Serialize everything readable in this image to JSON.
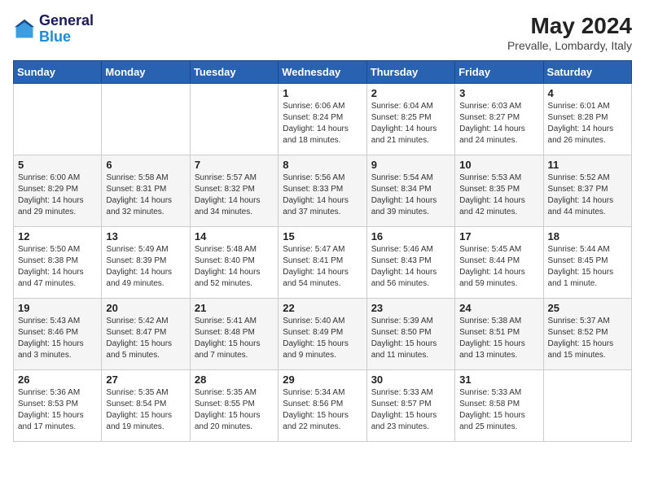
{
  "logo": {
    "line1": "General",
    "line2": "Blue"
  },
  "title": "May 2024",
  "location": "Prevalle, Lombardy, Italy",
  "weekdays": [
    "Sunday",
    "Monday",
    "Tuesday",
    "Wednesday",
    "Thursday",
    "Friday",
    "Saturday"
  ],
  "weeks": [
    [
      {
        "day": "",
        "text": ""
      },
      {
        "day": "",
        "text": ""
      },
      {
        "day": "",
        "text": ""
      },
      {
        "day": "1",
        "text": "Sunrise: 6:06 AM\nSunset: 8:24 PM\nDaylight: 14 hours and 18 minutes."
      },
      {
        "day": "2",
        "text": "Sunrise: 6:04 AM\nSunset: 8:25 PM\nDaylight: 14 hours and 21 minutes."
      },
      {
        "day": "3",
        "text": "Sunrise: 6:03 AM\nSunset: 8:27 PM\nDaylight: 14 hours and 24 minutes."
      },
      {
        "day": "4",
        "text": "Sunrise: 6:01 AM\nSunset: 8:28 PM\nDaylight: 14 hours and 26 minutes."
      }
    ],
    [
      {
        "day": "5",
        "text": "Sunrise: 6:00 AM\nSunset: 8:29 PM\nDaylight: 14 hours and 29 minutes."
      },
      {
        "day": "6",
        "text": "Sunrise: 5:58 AM\nSunset: 8:31 PM\nDaylight: 14 hours and 32 minutes."
      },
      {
        "day": "7",
        "text": "Sunrise: 5:57 AM\nSunset: 8:32 PM\nDaylight: 14 hours and 34 minutes."
      },
      {
        "day": "8",
        "text": "Sunrise: 5:56 AM\nSunset: 8:33 PM\nDaylight: 14 hours and 37 minutes."
      },
      {
        "day": "9",
        "text": "Sunrise: 5:54 AM\nSunset: 8:34 PM\nDaylight: 14 hours and 39 minutes."
      },
      {
        "day": "10",
        "text": "Sunrise: 5:53 AM\nSunset: 8:35 PM\nDaylight: 14 hours and 42 minutes."
      },
      {
        "day": "11",
        "text": "Sunrise: 5:52 AM\nSunset: 8:37 PM\nDaylight: 14 hours and 44 minutes."
      }
    ],
    [
      {
        "day": "12",
        "text": "Sunrise: 5:50 AM\nSunset: 8:38 PM\nDaylight: 14 hours and 47 minutes."
      },
      {
        "day": "13",
        "text": "Sunrise: 5:49 AM\nSunset: 8:39 PM\nDaylight: 14 hours and 49 minutes."
      },
      {
        "day": "14",
        "text": "Sunrise: 5:48 AM\nSunset: 8:40 PM\nDaylight: 14 hours and 52 minutes."
      },
      {
        "day": "15",
        "text": "Sunrise: 5:47 AM\nSunset: 8:41 PM\nDaylight: 14 hours and 54 minutes."
      },
      {
        "day": "16",
        "text": "Sunrise: 5:46 AM\nSunset: 8:43 PM\nDaylight: 14 hours and 56 minutes."
      },
      {
        "day": "17",
        "text": "Sunrise: 5:45 AM\nSunset: 8:44 PM\nDaylight: 14 hours and 59 minutes."
      },
      {
        "day": "18",
        "text": "Sunrise: 5:44 AM\nSunset: 8:45 PM\nDaylight: 15 hours and 1 minute."
      }
    ],
    [
      {
        "day": "19",
        "text": "Sunrise: 5:43 AM\nSunset: 8:46 PM\nDaylight: 15 hours and 3 minutes."
      },
      {
        "day": "20",
        "text": "Sunrise: 5:42 AM\nSunset: 8:47 PM\nDaylight: 15 hours and 5 minutes."
      },
      {
        "day": "21",
        "text": "Sunrise: 5:41 AM\nSunset: 8:48 PM\nDaylight: 15 hours and 7 minutes."
      },
      {
        "day": "22",
        "text": "Sunrise: 5:40 AM\nSunset: 8:49 PM\nDaylight: 15 hours and 9 minutes."
      },
      {
        "day": "23",
        "text": "Sunrise: 5:39 AM\nSunset: 8:50 PM\nDaylight: 15 hours and 11 minutes."
      },
      {
        "day": "24",
        "text": "Sunrise: 5:38 AM\nSunset: 8:51 PM\nDaylight: 15 hours and 13 minutes."
      },
      {
        "day": "25",
        "text": "Sunrise: 5:37 AM\nSunset: 8:52 PM\nDaylight: 15 hours and 15 minutes."
      }
    ],
    [
      {
        "day": "26",
        "text": "Sunrise: 5:36 AM\nSunset: 8:53 PM\nDaylight: 15 hours and 17 minutes."
      },
      {
        "day": "27",
        "text": "Sunrise: 5:35 AM\nSunset: 8:54 PM\nDaylight: 15 hours and 19 minutes."
      },
      {
        "day": "28",
        "text": "Sunrise: 5:35 AM\nSunset: 8:55 PM\nDaylight: 15 hours and 20 minutes."
      },
      {
        "day": "29",
        "text": "Sunrise: 5:34 AM\nSunset: 8:56 PM\nDaylight: 15 hours and 22 minutes."
      },
      {
        "day": "30",
        "text": "Sunrise: 5:33 AM\nSunset: 8:57 PM\nDaylight: 15 hours and 23 minutes."
      },
      {
        "day": "31",
        "text": "Sunrise: 5:33 AM\nSunset: 8:58 PM\nDaylight: 15 hours and 25 minutes."
      },
      {
        "day": "",
        "text": ""
      }
    ]
  ]
}
